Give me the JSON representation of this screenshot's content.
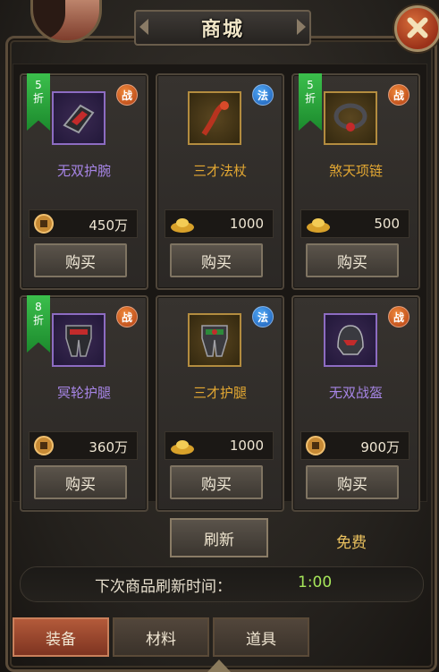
{
  "window": {
    "title": "商城"
  },
  "items": [
    {
      "name": "无双护腕",
      "class_badge": "战",
      "discount": "5折",
      "currency": "coin",
      "price": "450万",
      "buy_label": "购买",
      "rarity_color": "purple"
    },
    {
      "name": "三才法杖",
      "class_badge": "法",
      "discount": "",
      "currency": "ingot",
      "price": "1000",
      "buy_label": "购买",
      "rarity_color": "gold"
    },
    {
      "name": "煞天项链",
      "class_badge": "战",
      "discount": "5折",
      "currency": "ingot",
      "price": "500",
      "buy_label": "购买",
      "rarity_color": "gold"
    },
    {
      "name": "冥轮护腿",
      "class_badge": "战",
      "discount": "8折",
      "currency": "coin",
      "price": "360万",
      "buy_label": "购买",
      "rarity_color": "purple"
    },
    {
      "name": "三才护腿",
      "class_badge": "法",
      "discount": "",
      "currency": "ingot",
      "price": "1000",
      "buy_label": "购买",
      "rarity_color": "gold"
    },
    {
      "name": "无双战盔",
      "class_badge": "战",
      "discount": "",
      "currency": "coin",
      "price": "900万",
      "buy_label": "购买",
      "rarity_color": "purple"
    }
  ],
  "refresh": {
    "button_label": "刷新",
    "cost_text": "免费"
  },
  "timer": {
    "label": "下次商品刷新时间：",
    "value": "1:00"
  },
  "tabs": [
    {
      "label": "装备",
      "active": true
    },
    {
      "label": "材料",
      "active": false
    },
    {
      "label": "道具",
      "active": false
    }
  ],
  "colors": {
    "purple_name": "#a785e6",
    "gold_name": "#e4a832",
    "timer_value": "#a6e65a",
    "free_text": "#e9c05e",
    "active_tab": "#b35a3a"
  }
}
